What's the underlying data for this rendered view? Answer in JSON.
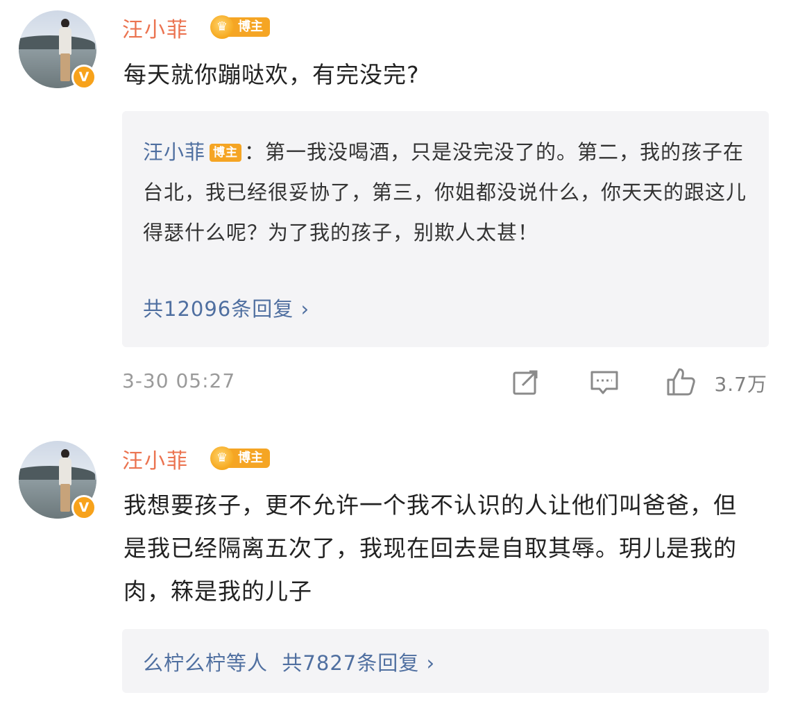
{
  "comments": [
    {
      "author": "汪小菲",
      "author_tag": "博主",
      "verified_icon": "v-verified-badge",
      "text": "每天就你蹦哒欢，有完没完?",
      "reply": {
        "author": "汪小菲",
        "author_tag": "博主",
        "separator": "：",
        "text": "第一我没喝酒，只是没完没了的。第二，我的孩子在台北，我已经很妥协了，第三，你姐都没说什么，你天天的跟这儿得瑟什么呢？为了我的孩子，别欺人太甚！",
        "count_text": "共12096条回复 ›"
      },
      "timestamp": "3-30 05:27",
      "actions": {
        "share_icon": "share-icon",
        "comment_icon": "comment-icon",
        "like_icon": "thumbs-up-icon",
        "like_count": "3.7万"
      }
    },
    {
      "author": "汪小菲",
      "author_tag": "博主",
      "verified_icon": "v-verified-badge",
      "text": "我想要孩子，更不允许一个我不认识的人让他们叫爸爸，但是我已经隔离五次了，我现在回去是自取其辱。玥儿是我的肉，箖是我的儿子",
      "reply": {
        "count_text": "么柠么柠等人  共7827条回复 ›"
      }
    }
  ],
  "colors": {
    "author_name": "#eb7350",
    "reply_link": "#4f6fa0",
    "tag_bg": "#f5a524",
    "reply_bg": "#f4f4f6",
    "meta_text": "#9a9a9a"
  }
}
